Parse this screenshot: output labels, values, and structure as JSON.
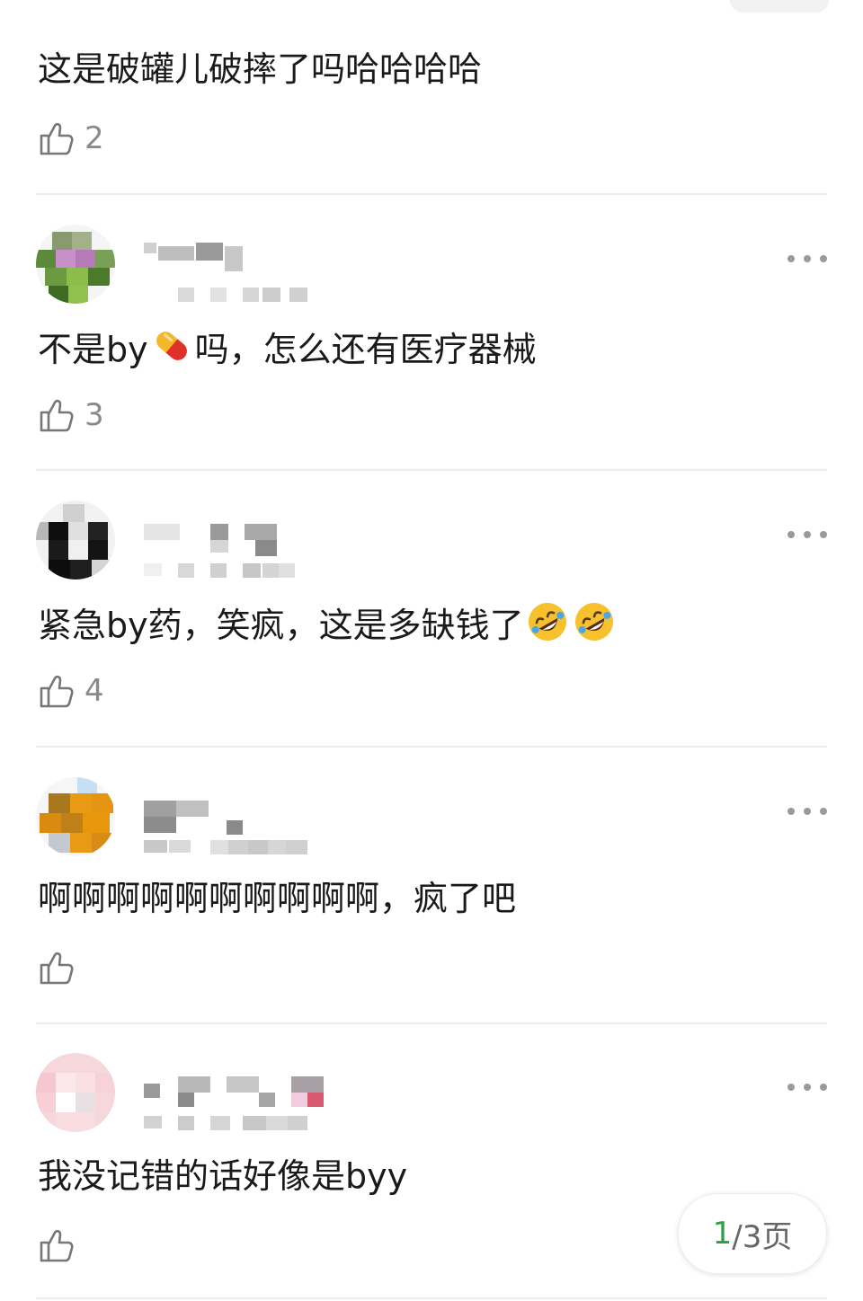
{
  "comments": [
    {
      "text": "这是破罐儿破摔了吗哈哈哈哈",
      "likes": "2"
    },
    {
      "text_before": "不是by",
      "text_after": "吗，怎么还有医疗器械",
      "emoji": "pill",
      "likes": "3"
    },
    {
      "text": "紧急by药，笑疯，这是多缺钱了",
      "emoji": "rolling-on-the-floor-laughing",
      "likes": "4"
    },
    {
      "text": "啊啊啊啊啊啊啊啊啊啊，疯了吧",
      "likes": ""
    },
    {
      "text": "我没记错的话好像是byy",
      "likes": ""
    }
  ],
  "pager": {
    "current": "1",
    "rest": "/3页"
  },
  "colors": {
    "accent_green": "#2f9e48",
    "text": "#1a1a1a",
    "muted": "#8a8a8a",
    "divider": "#ececec"
  }
}
